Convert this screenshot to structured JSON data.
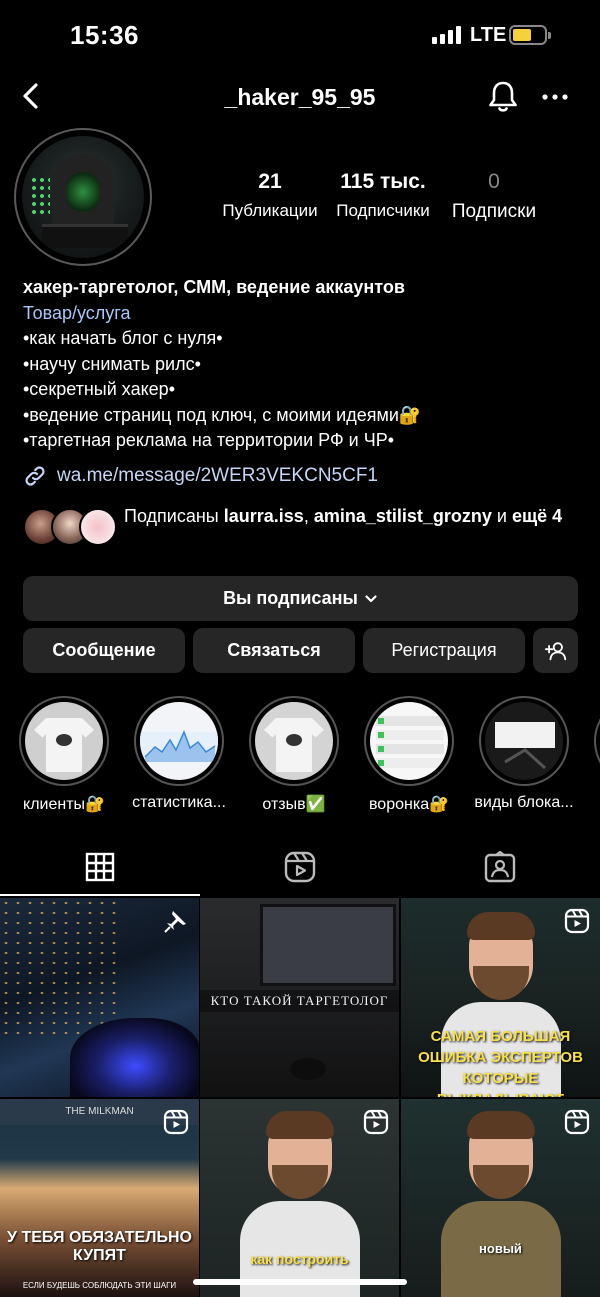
{
  "status_bar": {
    "time": "15:36",
    "network": "LTE"
  },
  "header": {
    "username": "_haker_95_95"
  },
  "stats": [
    {
      "value": "21",
      "label": "Публикации"
    },
    {
      "value": "115 тыс.",
      "label": "Подписчики"
    },
    {
      "value": "0",
      "label": "Подписки"
    }
  ],
  "bio": {
    "name": "хакер-таргетолог, СММ, ведение аккаунтов",
    "category": "Товар/услуга",
    "lines": [
      "•как начать блог с нуля•",
      "•научу снимать рилс•",
      "•секретный хакер•",
      "•ведение страниц под ключ, с моими идеями🔐",
      "•таргетная реклама на территории РФ и ЧР•"
    ]
  },
  "link": {
    "text": "wa.me/message/2WER3VEKCN5CF1"
  },
  "followed_by": {
    "prefix": "Подписаны ",
    "user1": "laurra.iss",
    "sep": ", ",
    "user2": "amina_stilist_grozny",
    "and": " и ",
    "more": "ещё 4"
  },
  "buttons": {
    "following": "Вы подписаны",
    "message": "Сообщение",
    "contact": "Связаться",
    "register": "Регистрация"
  },
  "highlights": [
    {
      "label": "клиенты🔐"
    },
    {
      "label": "статистика..."
    },
    {
      "label": "отзыв✅"
    },
    {
      "label": "воронка🔐"
    },
    {
      "label": "виды блока..."
    }
  ],
  "posts": [
    {
      "caption": ""
    },
    {
      "caption": "КТО ТАКОЙ ТАРГЕТОЛОГ"
    },
    {
      "caption": "САМАЯ БОЛЬШАЯ ОШИБКА ЭКСПЕРТОВ КОТОРЫЕ ВЫКЛАДЫВАЮТ REELS"
    },
    {
      "caption": "У ТЕБЯ ОБЯЗАТЕЛЬНО КУПЯТ",
      "sub": "ЕСЛИ БУДЕШЬ СОБЛЮДАТЬ ЭТИ ШАГИ",
      "sign": "THE MILKMAN"
    },
    {
      "caption": "как построить"
    },
    {
      "caption": "новый"
    }
  ]
}
